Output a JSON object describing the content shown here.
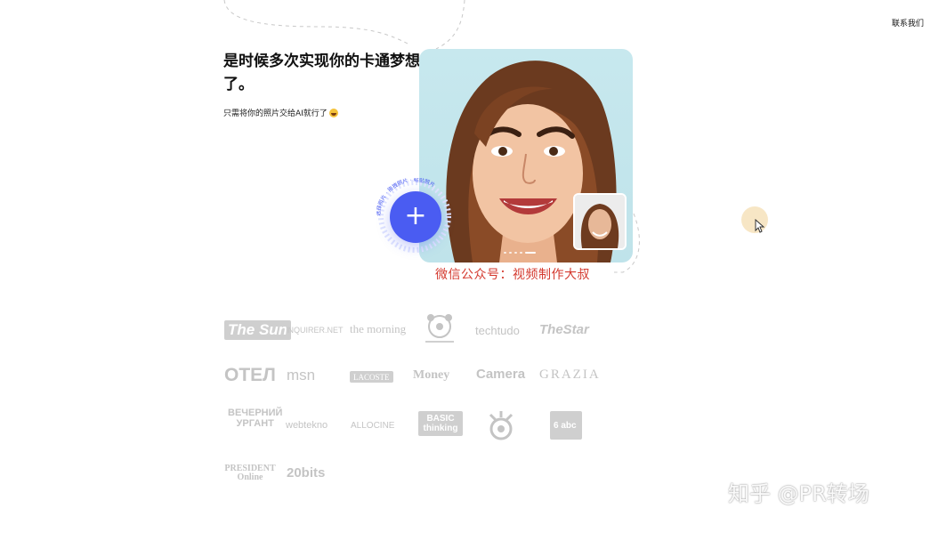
{
  "header": {
    "contact_label": "联系我们"
  },
  "hero": {
    "title": "是时候多次实现你的卡通梦想了。",
    "subtitle": "只需将你的照片交给AI就行了"
  },
  "upload": {
    "icon": "plus-icon",
    "ring_text": "选择照片 · 拖拽照片 · 粘贴照片"
  },
  "overlay": {
    "red_caption": "微信公众号：视频制作大叔",
    "zhihu_watermark": "知乎 @PR转场"
  },
  "logos": [
    "The Sun",
    "INQUIRER.NET",
    "the morning",
    "",
    "techtudo",
    "TheStar",
    "ОТЕЛ",
    "msn",
    "LACOSTE",
    "Money",
    "Camera",
    "GRAZIA",
    "ВЕЧЕРНИЙ УРГАНТ",
    "webtekno",
    "ALLOCINE",
    "BASIC thinking",
    "",
    "6 abc",
    "PRESIDENT Online",
    "20bits"
  ],
  "colors": {
    "accent": "#4a5cf2",
    "card_bg": "#c7e8ee",
    "logo_gray": "#c4c4c4",
    "caption_red": "#d43a2f"
  }
}
